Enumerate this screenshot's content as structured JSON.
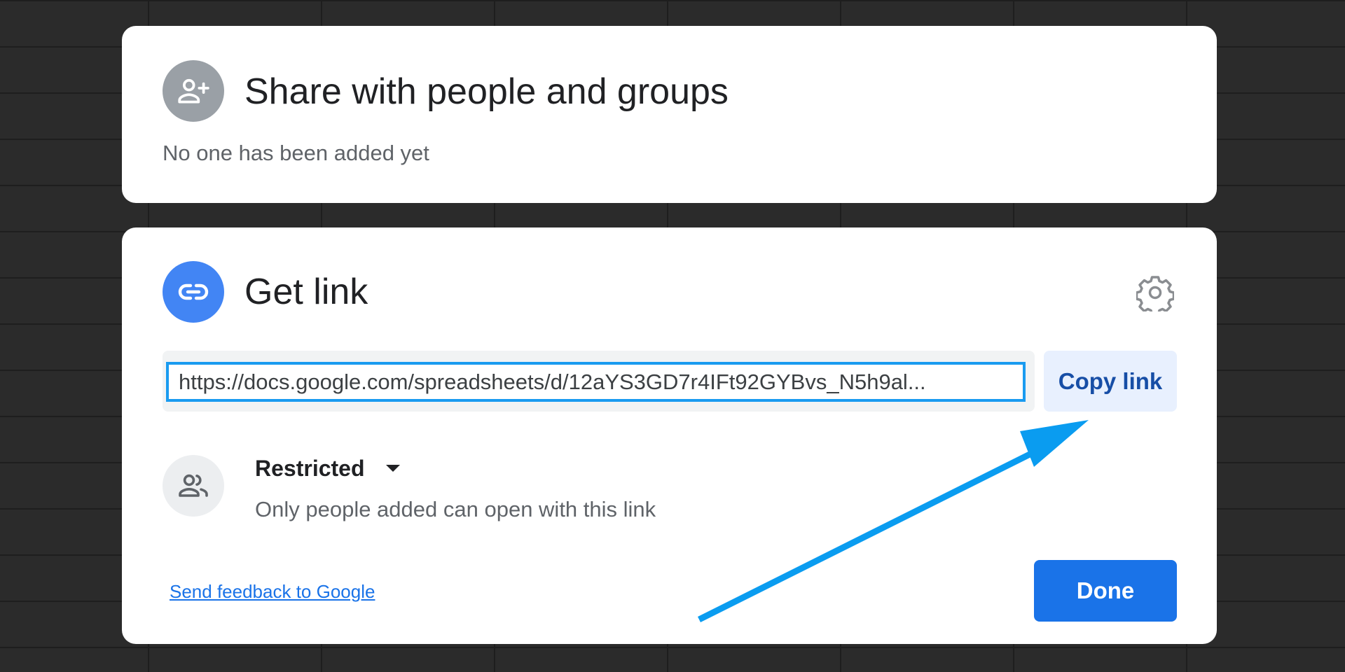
{
  "share_section": {
    "title": "Share with people and groups",
    "subtitle": "No one has been added yet",
    "icon": "person-add-icon"
  },
  "link_section": {
    "title": "Get link",
    "icon": "link-icon",
    "settings_icon": "gear-icon",
    "url": "https://docs.google.com/spreadsheets/d/12aYS3GD7r4IFt92GYBvs_N5h9al...",
    "copy_label": "Copy link",
    "access": {
      "level": "Restricted",
      "description": "Only people added can open with this link",
      "icon": "people-icon"
    },
    "feedback_label": "Send feedback to Google",
    "done_label": "Done"
  },
  "annotation": {
    "type": "arrow",
    "points_to": "copy-link-button",
    "color": "#0a9cf0"
  },
  "colors": {
    "primary": "#1a73e8",
    "link_icon_bg": "#4285f4",
    "copy_button_bg": "#e8f0fe",
    "copy_button_text": "#174ea6",
    "focus_border": "#1a9bf0"
  }
}
